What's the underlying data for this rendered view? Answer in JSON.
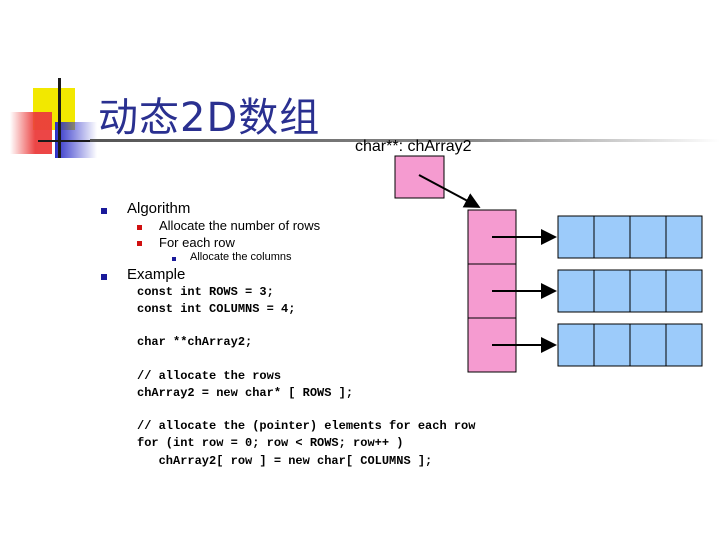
{
  "slide": {
    "title": "动态2D数组",
    "bullets": {
      "algorithm": "Algorithm",
      "allocate_rows": "Allocate the number of rows",
      "for_each_row": "For each row",
      "allocate_columns": "Allocate the columns",
      "example": "Example"
    },
    "code_lines": [
      "const int ROWS = 3;",
      "const int COLUMNS = 4;",
      "char **chArray2;",
      "// allocate the rows",
      "chArray2 = new char* [ ROWS ];",
      "// allocate the (pointer) elements for each row",
      "for (int row = 0; row < ROWS; row++ )",
      "   chArray2[ row ] = new char[ COLUMNS ];"
    ],
    "diagram": {
      "label": "char**: chArray2",
      "rows": 3,
      "columns": 4,
      "colors": {
        "pointer_fill": "#f59bd0",
        "cell_fill": "#9ccbfa",
        "title_color": "#2a3090",
        "bullet_blue": "#1a1a9a",
        "bullet_red": "#d01010"
      }
    }
  }
}
